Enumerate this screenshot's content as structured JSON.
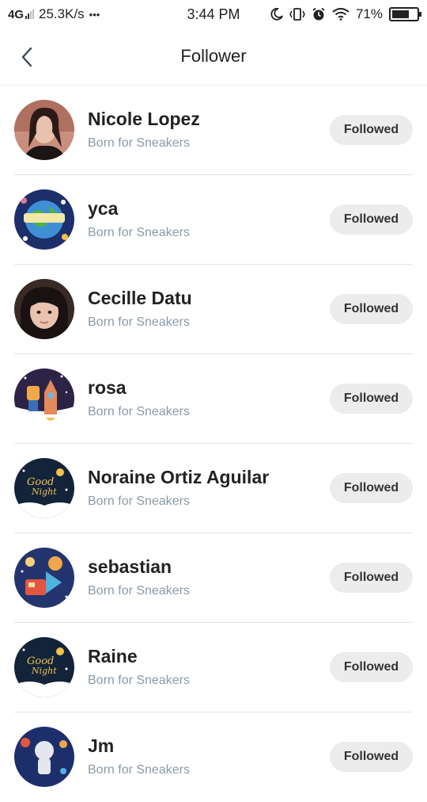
{
  "status_bar": {
    "network": "4G",
    "speed": "25.3K/s",
    "more": "•••",
    "time": "3:44 PM",
    "battery_text": "71%",
    "battery_level": 0.71
  },
  "header": {
    "title": "Follower"
  },
  "followers": [
    {
      "name": "Nicole Lopez",
      "bio": "Born for Sneakers",
      "button": "Followed"
    },
    {
      "name": "yca",
      "bio": "Born for Sneakers",
      "button": "Followed"
    },
    {
      "name": "Cecille Datu",
      "bio": "Born for Sneakers",
      "button": "Followed"
    },
    {
      "name": "rosa",
      "bio": "Born for Sneakers",
      "button": "Followed"
    },
    {
      "name": "Noraine Ortiz Aguilar",
      "bio": "Born for Sneakers",
      "button": "Followed"
    },
    {
      "name": "sebastian",
      "bio": "Born for Sneakers",
      "button": "Followed"
    },
    {
      "name": "Raine",
      "bio": "Born for Sneakers",
      "button": "Followed"
    },
    {
      "name": "Jm",
      "bio": "Born for Sneakers",
      "button": "Followed"
    }
  ]
}
